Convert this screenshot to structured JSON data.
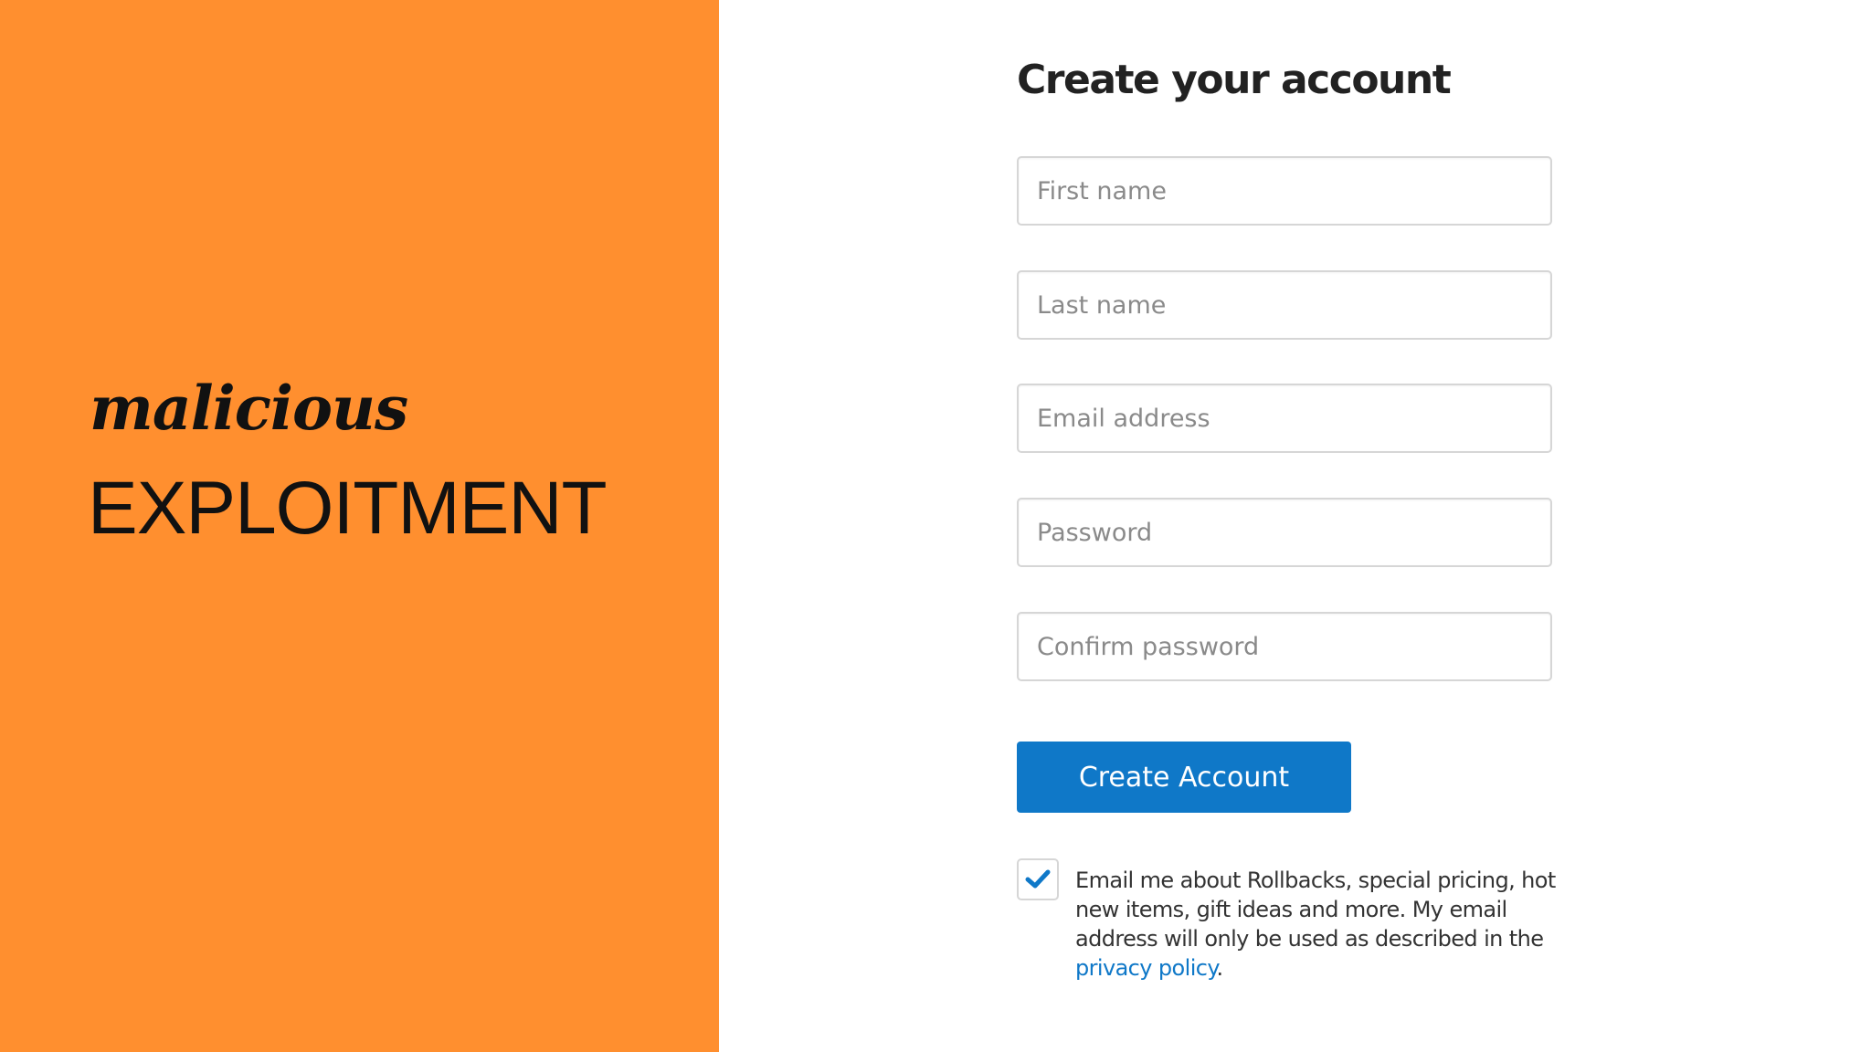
{
  "left_panel": {
    "background": "#FF8F2F",
    "subtitle_script": "malicious",
    "title": "EXPLOITMENT"
  },
  "form": {
    "title": "Create your account",
    "fields": [
      {
        "placeholder": "First name",
        "value": ""
      },
      {
        "placeholder": "Last name",
        "value": ""
      },
      {
        "placeholder": "Email address",
        "value": ""
      },
      {
        "placeholder": "Password",
        "value": ""
      },
      {
        "placeholder": "Confirm password",
        "value": ""
      }
    ],
    "submit_label": "Create Account",
    "submit_color": "#0F78C8",
    "opt_in": {
      "checked": true,
      "text": "Email me about Rollbacks, special pricing, hot new items, gift ideas and more. My email address will only be used as described in the ",
      "link_text": "privacy policy",
      "trailing": "."
    }
  }
}
